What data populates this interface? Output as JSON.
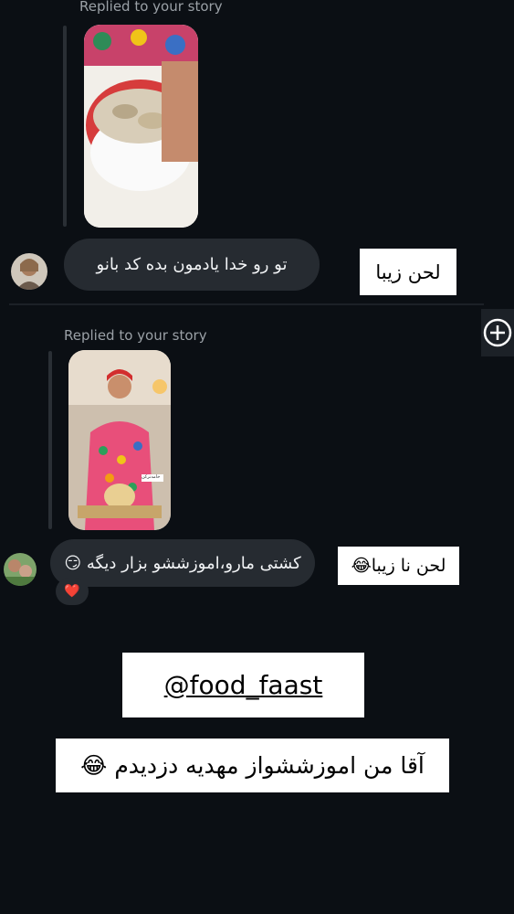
{
  "thread1": {
    "replied_label": "Replied to your story",
    "message": "تو رو خدا یادمون بده کد بانو",
    "overlay_label": "لحن زیبا"
  },
  "thread2": {
    "replied_label": "Replied to your story",
    "message": "کشتی مارو،اموزششو بزار دیگه 😏",
    "reaction": "❤️",
    "overlay_label": "لحن نا زیبا😂",
    "story_caption": "خامه‌ترکن"
  },
  "handle": "@food_faast",
  "caption": "آقا من اموزششواز مهدیه دزدیدم 😂",
  "icons": {
    "add": "add-circle-icon",
    "reaction": "heart-icon"
  }
}
